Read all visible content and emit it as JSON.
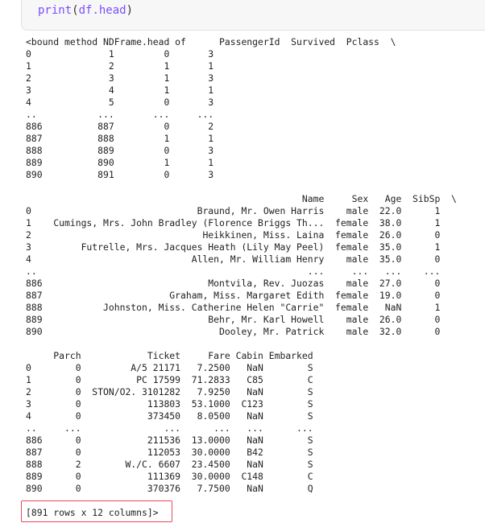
{
  "code_cell": {
    "func": "print",
    "open_paren": "(",
    "arg": "df.head",
    "close_paren": ")"
  },
  "output": {
    "block1": "<bound method NDFrame.head of      PassengerId  Survived  Pclass  \\\n0              1         0       3  \n1              2         1       1  \n2              3         1       3  \n3              4         1       1  \n4              5         0       3  \n..           ...       ...     ...  \n886          887         0       2  \n887          888         1       1  \n888          889         0       3  \n889          890         1       1  \n890          891         0       3  ",
    "block2": "                                                  Name     Sex   Age  SibSp  \\\n0                              Braund, Mr. Owen Harris    male  22.0      1   \n1    Cumings, Mrs. John Bradley (Florence Briggs Th...  female  38.0      1   \n2                               Heikkinen, Miss. Laina  female  26.0      0   \n3         Futrelle, Mrs. Jacques Heath (Lily May Peel)  female  35.0      1   \n4                             Allen, Mr. William Henry    male  35.0      0   \n..                                                 ...     ...   ...    ...   \n886                              Montvila, Rev. Juozas    male  27.0      0   \n887                       Graham, Miss. Margaret Edith  female  19.0      0   \n888           Johnston, Miss. Catherine Helen \"Carrie\"  female   NaN      1   \n889                              Behr, Mr. Karl Howell    male  26.0      0   \n890                                Dooley, Mr. Patrick    male  32.0      0   ",
    "block3": "     Parch            Ticket     Fare Cabin Embarked  \n0        0         A/5 21171   7.2500   NaN        S  \n1        0          PC 17599  71.2833   C85        C  \n2        0  STON/O2. 3101282   7.9250   NaN        S  \n3        0            113803  53.1000  C123        S  \n4        0            373450   8.0500   NaN        S  \n..     ...               ...      ...   ...      ...  \n886      0            211536  13.0000   NaN        S  \n887      0            112053  30.0000   B42        S  \n888      2        W./C. 6607  23.4500   NaN        S  \n889      0            111369  30.0000  C148        C  \n890      0            370376   7.7500   NaN        Q  ",
    "summary": "[891 rows x 12 columns]>"
  },
  "colors": {
    "function_name": "#7c4dff",
    "highlight_border": "#e84a5a",
    "code_background": "#f7f7f7"
  }
}
